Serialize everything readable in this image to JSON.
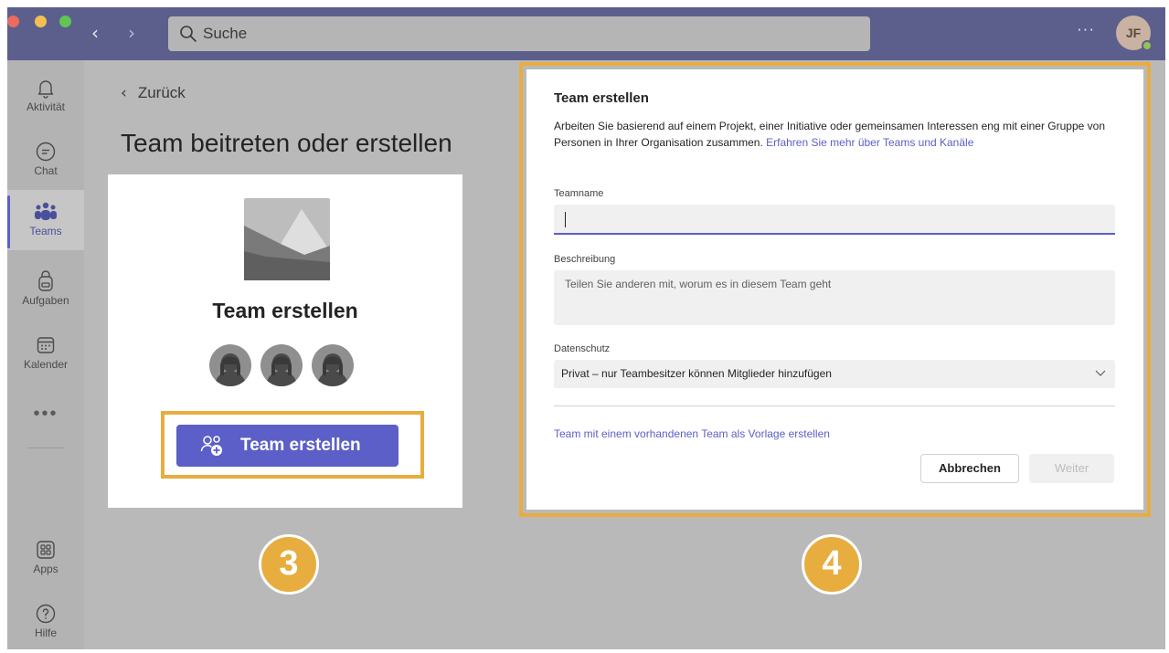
{
  "titlebar": {
    "search_placeholder": "Suche",
    "more_label": "···",
    "avatar_initials": "JF"
  },
  "rail": {
    "items": [
      {
        "label": "Aktivität",
        "icon": "bell-icon"
      },
      {
        "label": "Chat",
        "icon": "chat-icon"
      },
      {
        "label": "Teams",
        "icon": "teams-icon",
        "active": true
      },
      {
        "label": "Aufgaben",
        "icon": "backpack-icon"
      },
      {
        "label": "Kalender",
        "icon": "calendar-icon"
      },
      {
        "label": "Apps",
        "icon": "apps-icon"
      },
      {
        "label": "Hilfe",
        "icon": "help-icon"
      }
    ],
    "more_label": "•••"
  },
  "main": {
    "back_label": "Zurück",
    "title": "Team beitreten oder erstellen",
    "card": {
      "title": "Team erstellen",
      "button_label": "Team erstellen"
    }
  },
  "dialog": {
    "title": "Team erstellen",
    "description": "Arbeiten Sie basierend auf einem Projekt, einer Initiative oder gemeinsamen Interessen eng mit einer Gruppe von Personen in Ihrer Organisation zusammen. ",
    "learn_more_link": "Erfahren Sie mehr über Teams und Kanäle",
    "team_name_label": "Teamname",
    "team_name_value": "",
    "description_label": "Beschreibung",
    "description_placeholder": "Teilen Sie anderen mit, worum es in diesem Team geht",
    "privacy_label": "Datenschutz",
    "privacy_value": "Privat – nur Teambesitzer können Mitglieder hinzufügen",
    "template_link": "Team mit einem vorhandenen Team als Vorlage erstellen",
    "cancel_label": "Abbrechen",
    "next_label": "Weiter"
  },
  "badges": {
    "step_3": "3",
    "step_4": "4"
  },
  "colors": {
    "accent": "#5b5fc7",
    "highlight": "#e8ad3f",
    "titlebar": "#5c5f8c"
  }
}
